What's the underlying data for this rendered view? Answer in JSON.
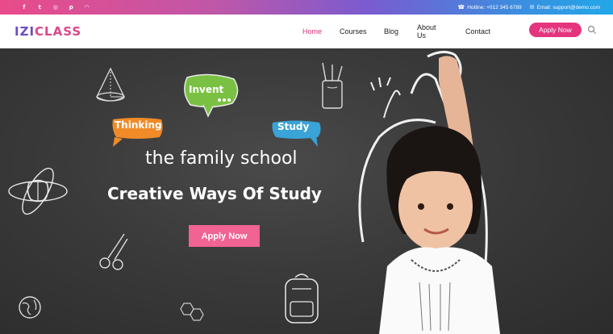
{
  "topbar": {
    "social": [
      {
        "icon": "facebook-icon",
        "glyph": "f"
      },
      {
        "icon": "twitter-icon",
        "glyph": "t"
      },
      {
        "icon": "instagram-icon",
        "glyph": "◎"
      },
      {
        "icon": "pinterest-icon",
        "glyph": "p"
      },
      {
        "icon": "rss-icon",
        "glyph": "◠"
      }
    ],
    "hotline": "Hotline: +012 345 6789",
    "email": "Email: support@demo.com",
    "gradient_colors": [
      "#e94b8a",
      "#7a5bd0",
      "#22a7e8"
    ]
  },
  "nav": {
    "logo_part1": "IZI",
    "logo_part2": "CLASS",
    "items": [
      {
        "label": "Home",
        "active": true
      },
      {
        "label": "Courses",
        "active": false
      },
      {
        "label": "Blog",
        "active": false
      },
      {
        "label": "About Us",
        "active": false
      },
      {
        "label": "Contact",
        "active": false
      }
    ],
    "apply_label": "Apply Now",
    "accent": "#e5357e"
  },
  "hero": {
    "tagline": "the family school",
    "headline": "Creative Ways Of Study",
    "button_label": "Apply Now",
    "bubbles": {
      "invent": "Invent",
      "thinking": "Thinking",
      "study": "Study"
    },
    "button_color": "#f06393"
  }
}
